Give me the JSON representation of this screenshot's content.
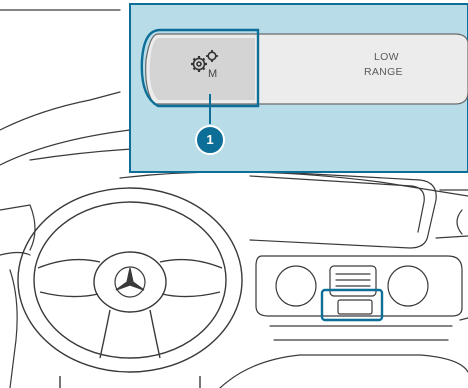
{
  "callout": {
    "number": "1",
    "color": "#0d6f98",
    "panel_color": "#b8dce8"
  },
  "switch_panel": {
    "left_icon": "gear-m-icon",
    "left_icon_letter": "M",
    "right_label_line1": "LOW",
    "right_label_line2": "RANGE"
  },
  "scene": {
    "steering_logo": "star-emblem-icon",
    "highlight": "low-range-switch"
  }
}
